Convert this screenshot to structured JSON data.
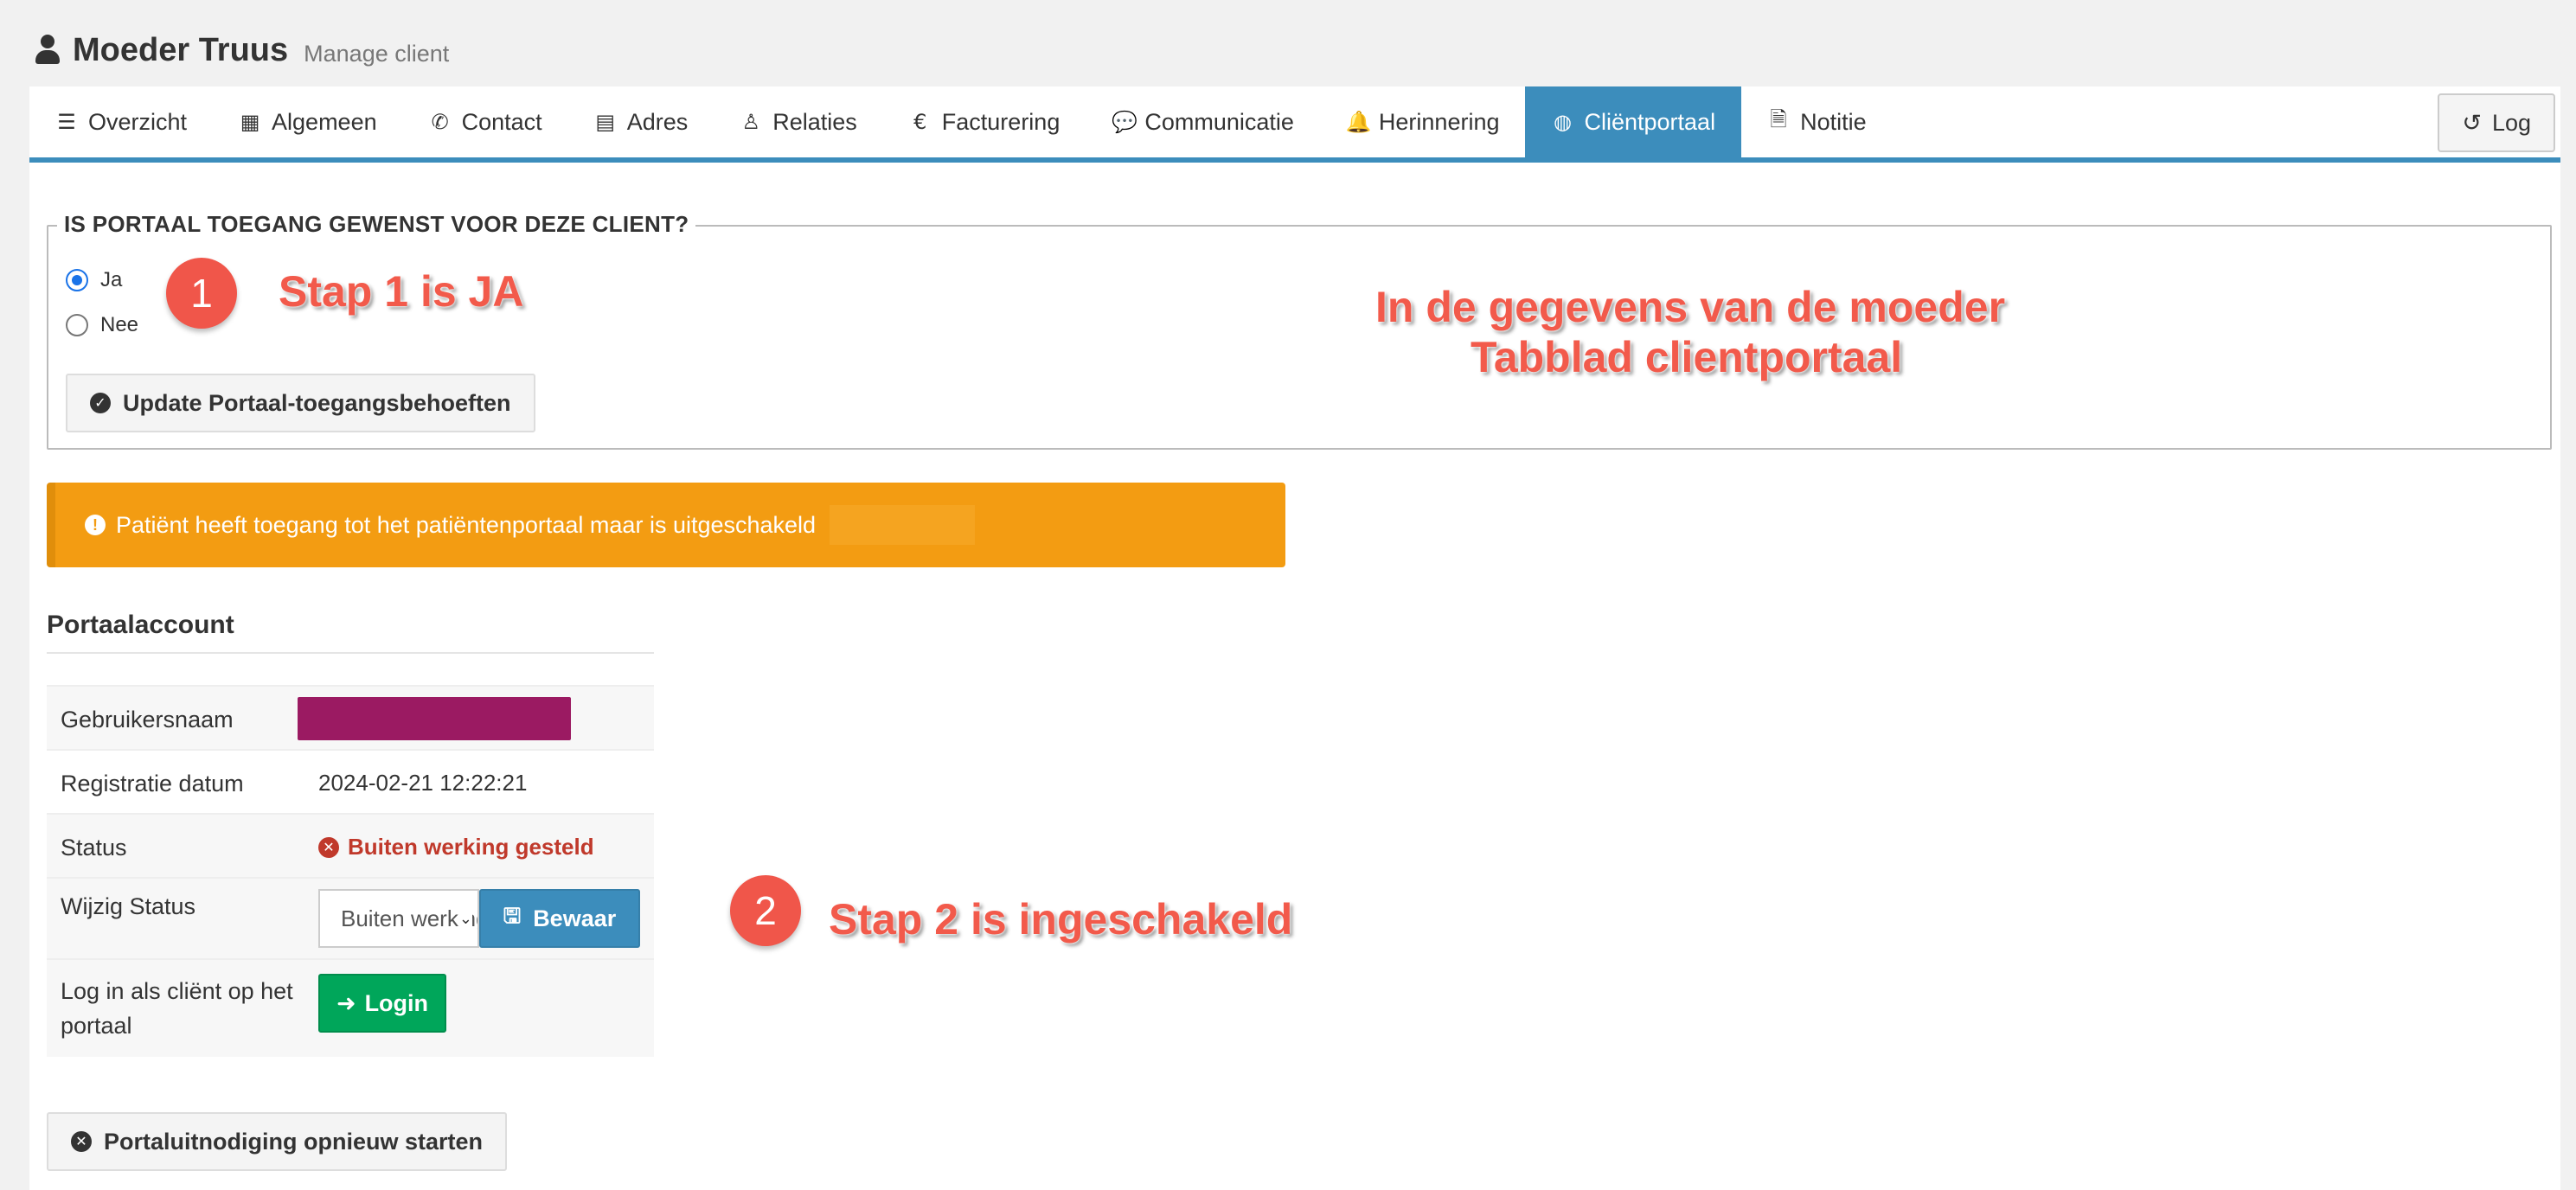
{
  "header": {
    "title": "Moeder Truus",
    "subtitle": "Manage client",
    "icon": "user-icon"
  },
  "tabs": [
    {
      "label": "Overzicht",
      "icon": "list-icon",
      "glyph": "☰"
    },
    {
      "label": "Algemeen",
      "icon": "table-icon",
      "glyph": "▦"
    },
    {
      "label": "Contact",
      "icon": "phone-icon",
      "glyph": "✆"
    },
    {
      "label": "Adres",
      "icon": "map-icon",
      "glyph": "▤"
    },
    {
      "label": "Relaties",
      "icon": "child-icon",
      "glyph": "♙"
    },
    {
      "label": "Facturering",
      "icon": "euro-icon",
      "glyph": "€"
    },
    {
      "label": "Communicatie",
      "icon": "comments-icon",
      "glyph": "💬"
    },
    {
      "label": "Herinnering",
      "icon": "bell-icon",
      "glyph": "🔔"
    },
    {
      "label": "Cliëntportaal",
      "icon": "globe-icon",
      "glyph": "◍",
      "active": true
    },
    {
      "label": "Notitie",
      "icon": "file-icon",
      "glyph": "🗎"
    }
  ],
  "log_button": {
    "label": "Log",
    "icon": "history-icon",
    "glyph": "↺"
  },
  "portal_access": {
    "legend": "IS PORTAAL TOEGANG GEWENST VOOR DEZE CLIENT?",
    "options": [
      {
        "label": "Ja",
        "checked": true
      },
      {
        "label": "Nee",
        "checked": false
      }
    ],
    "update_button": "Update Portaal-toegangsbehoeften"
  },
  "annotations": {
    "step1_number": "1",
    "step1_text": "Stap 1 is JA",
    "note_line1": "In de gegevens van de moeder",
    "note_line2": "Tabblad clientportaal",
    "step2_number": "2",
    "step2_text": "Stap 2 is ingeschakeld",
    "color": "#f25a4b"
  },
  "alert": {
    "text": "Patiënt heeft toegang tot het patiëntenportaal maar is uitgeschakeld",
    "color": "#f39c12"
  },
  "account": {
    "title": "Portaalaccount",
    "username_label": "Gebruikersnaam",
    "registration_label": "Registratie datum",
    "registration_value": "2024-02-21 12:22:21",
    "status_label": "Status",
    "status_value": "Buiten werking gesteld",
    "change_status_label": "Wijzig Status",
    "status_select_value": "Buiten werking gesteld",
    "save_button": "Bewaar",
    "login_label": "Log in als cliënt op het portaal",
    "login_button": "Login"
  },
  "restart_button": "Portaluitnodiging opnieuw starten",
  "colors": {
    "primary": "#3c8dbc",
    "success": "#00a65a",
    "danger": "#c0392b",
    "warning": "#f39c12"
  }
}
